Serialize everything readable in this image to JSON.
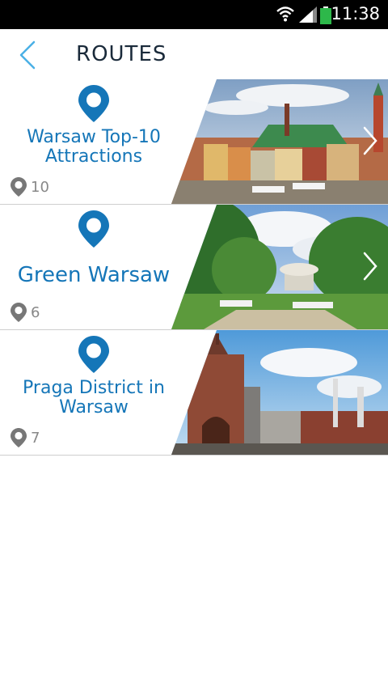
{
  "status": {
    "time": "11:38"
  },
  "header": {
    "title": "ROUTES"
  },
  "routes": [
    {
      "name": "Warsaw Top-10 Attractions",
      "count": "10"
    },
    {
      "name": "Green Warsaw",
      "count": "6"
    },
    {
      "name": "Praga District in Warsaw",
      "count": "7"
    }
  ],
  "colors": {
    "accent": "#1576b8",
    "back_arrow": "#4ab0e6",
    "count_icon": "#777777"
  }
}
